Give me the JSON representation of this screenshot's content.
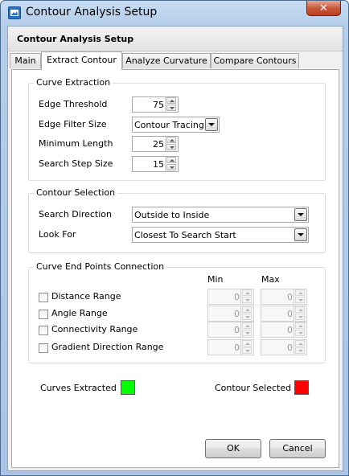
{
  "window": {
    "title": "Contour Analysis Setup",
    "close_icon": "close-icon",
    "app_icon": "app-icon"
  },
  "header": {
    "title": "Contour Analysis Setup"
  },
  "tabs": [
    {
      "label": "Main",
      "active": false
    },
    {
      "label": "Extract Contour",
      "active": true
    },
    {
      "label": "Analyze Curvature",
      "active": false
    },
    {
      "label": "Compare Contours",
      "active": false
    }
  ],
  "curve_extraction": {
    "legend": "Curve Extraction",
    "edge_threshold": {
      "label": "Edge Threshold",
      "value": "75"
    },
    "edge_filter_size": {
      "label": "Edge Filter Size",
      "value": "Contour Tracing"
    },
    "minimum_length": {
      "label": "Minimum Length",
      "value": "25"
    },
    "search_step_size": {
      "label": "Search Step Size",
      "value": "15"
    }
  },
  "contour_selection": {
    "legend": "Contour Selection",
    "search_direction": {
      "label": "Search Direction",
      "value": "Outside to Inside"
    },
    "look_for": {
      "label": "Look For",
      "value": "Closest To Search Start"
    }
  },
  "curve_end_points": {
    "legend": "Curve End Points Connection",
    "min_header": "Min",
    "max_header": "Max",
    "rows": [
      {
        "label": "Distance Range",
        "checked": false,
        "min": "0",
        "max": "0"
      },
      {
        "label": "Angle Range",
        "checked": false,
        "min": "0",
        "max": "0"
      },
      {
        "label": "Connectivity Range",
        "checked": false,
        "min": "0",
        "max": "0"
      },
      {
        "label": "Gradient Direction Range",
        "checked": false,
        "min": "0",
        "max": "0"
      }
    ]
  },
  "legend_colors": {
    "curves_extracted": {
      "label": "Curves Extracted",
      "color": "#00ff00"
    },
    "contour_selected": {
      "label": "Contour Selected",
      "color": "#ff0000"
    }
  },
  "buttons": {
    "ok": "OK",
    "cancel": "Cancel"
  }
}
